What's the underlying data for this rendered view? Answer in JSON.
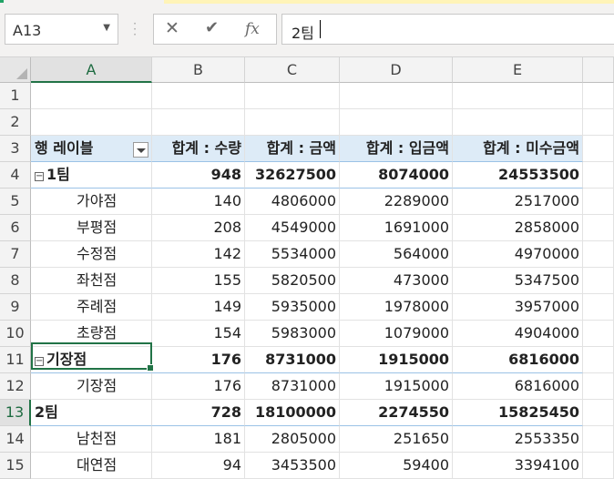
{
  "name_box": "A13",
  "formula_bar": {
    "cancel_icon": "x-icon",
    "enter_icon": "check-icon",
    "function_label": "fx",
    "value": "2팀"
  },
  "columns": [
    "A",
    "B",
    "C",
    "D",
    "E"
  ],
  "rows": [
    "1",
    "2",
    "3",
    "4",
    "5",
    "6",
    "7",
    "8",
    "9",
    "10",
    "11",
    "12",
    "13",
    "14",
    "15"
  ],
  "pivot": {
    "headers": [
      "행 레이블",
      "합계 : 수량",
      "합계 : 금액",
      "합계 : 입금액",
      "합계 : 미수금액"
    ],
    "rows": [
      {
        "label": "1팀",
        "level": 0,
        "toggle": "⊟",
        "values": [
          "948",
          "32627500",
          "8074000",
          "24553500"
        ]
      },
      {
        "label": "가야점",
        "level": 1,
        "values": [
          "140",
          "4806000",
          "2289000",
          "2517000"
        ]
      },
      {
        "label": "부평점",
        "level": 1,
        "values": [
          "208",
          "4549000",
          "1691000",
          "2858000"
        ]
      },
      {
        "label": "수정점",
        "level": 1,
        "values": [
          "142",
          "5534000",
          "564000",
          "4970000"
        ]
      },
      {
        "label": "좌천점",
        "level": 1,
        "values": [
          "155",
          "5820500",
          "473000",
          "5347500"
        ]
      },
      {
        "label": "주례점",
        "level": 1,
        "values": [
          "149",
          "5935000",
          "1978000",
          "3957000"
        ]
      },
      {
        "label": "초량점",
        "level": 1,
        "values": [
          "154",
          "5983000",
          "1079000",
          "4904000"
        ]
      },
      {
        "label": "기장점",
        "level": 0,
        "toggle": "⊟",
        "values": [
          "176",
          "8731000",
          "1915000",
          "6816000"
        ]
      },
      {
        "label": "기장점",
        "level": 1,
        "values": [
          "176",
          "8731000",
          "1915000",
          "6816000"
        ]
      },
      {
        "label": "2팀",
        "level": 0,
        "values": [
          "728",
          "18100000",
          "2274550",
          "15825450"
        ]
      },
      {
        "label": "남천점",
        "level": 1,
        "values": [
          "181",
          "2805000",
          "251650",
          "2553350"
        ]
      },
      {
        "label": "대연점",
        "level": 1,
        "values": [
          "94",
          "3453500",
          "59400",
          "3394100"
        ]
      }
    ]
  },
  "accent_color": "#217346",
  "header_fill": "#ddebf7"
}
